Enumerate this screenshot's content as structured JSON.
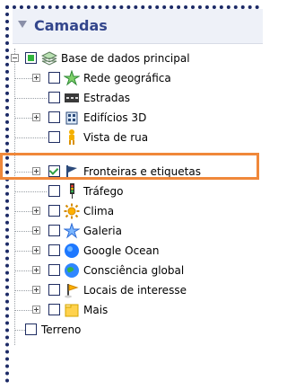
{
  "panel": {
    "title": "Camadas",
    "items": [
      {
        "label": "Base de dados principal",
        "icon": "layers-icon",
        "state": "partial",
        "expander": "minus"
      },
      {
        "label": "Rede geográfica",
        "icon": "star-icon",
        "state": "unchecked",
        "expander": "plus"
      },
      {
        "label": "Estradas",
        "icon": "road-icon",
        "state": "unchecked",
        "expander": "none"
      },
      {
        "label": "Edifícios 3D",
        "icon": "building-icon",
        "state": "unchecked",
        "expander": "plus"
      },
      {
        "label": "Vista de rua",
        "icon": "pegman-icon",
        "state": "unchecked",
        "expander": "none"
      },
      {
        "label": "Fronteiras e etiquetas",
        "icon": "flag-icon",
        "state": "checked",
        "expander": "plus"
      },
      {
        "label": "Tráfego",
        "icon": "traffic-light-icon",
        "state": "unchecked",
        "expander": "none"
      },
      {
        "label": "Clima",
        "icon": "sun-icon",
        "state": "unchecked",
        "expander": "plus"
      },
      {
        "label": "Galeria",
        "icon": "gallery-star-icon",
        "state": "unchecked",
        "expander": "plus"
      },
      {
        "label": "Google Ocean",
        "icon": "ocean-globe-icon",
        "state": "unchecked",
        "expander": "plus"
      },
      {
        "label": "Consciência global",
        "icon": "globe-icon",
        "state": "unchecked",
        "expander": "plus"
      },
      {
        "label": "Locais de interesse",
        "icon": "pin-flag-icon",
        "state": "unchecked",
        "expander": "plus"
      },
      {
        "label": "Mais",
        "icon": "folder-icon",
        "state": "unchecked",
        "expander": "plus"
      },
      {
        "label": "Terreno",
        "icon": "",
        "state": "unchecked",
        "expander": "none"
      }
    ]
  }
}
